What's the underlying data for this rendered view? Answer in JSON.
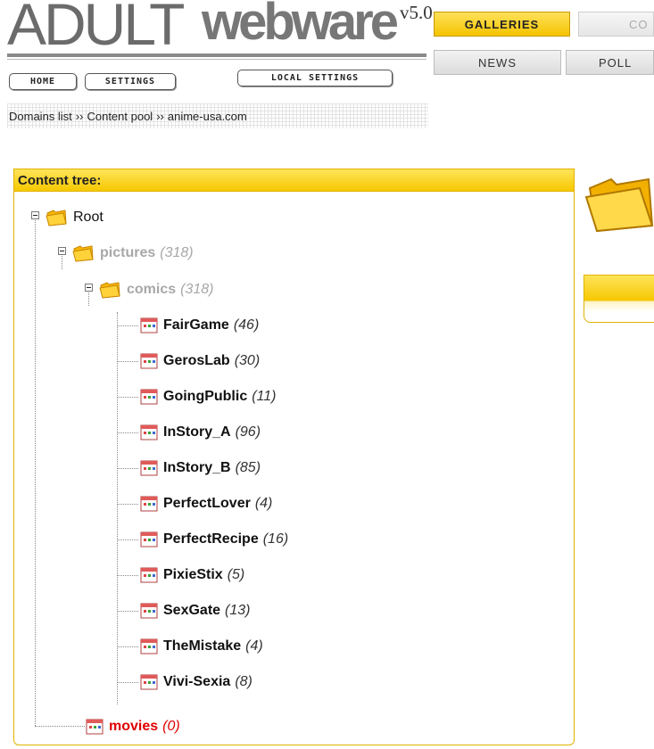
{
  "header": {
    "logo_adult": "ADULT",
    "logo_webware": "webware",
    "version": "v5.0",
    "buttons": {
      "home": "HOME",
      "settings": "SETTINGS",
      "local_settings": "LOCAL SETTINGS"
    },
    "tabs": {
      "galleries": "GALLERIES",
      "content": "CO",
      "news": "NEWS",
      "poll": "POLL"
    }
  },
  "breadcrumb": {
    "items": [
      "Domains list",
      "Content pool",
      "anime-usa.com"
    ],
    "separator": "››"
  },
  "tree": {
    "title": "Content tree:",
    "root": "Root",
    "pictures": {
      "name": "pictures",
      "count": "(318)"
    },
    "comics": {
      "name": "comics",
      "count": "(318)"
    },
    "galleries": [
      {
        "name": "FairGame",
        "count": "(46)"
      },
      {
        "name": "GerosLab",
        "count": "(30)"
      },
      {
        "name": "GoingPublic",
        "count": "(11)"
      },
      {
        "name": "InStory_A",
        "count": "(96)"
      },
      {
        "name": "InStory_B",
        "count": "(85)"
      },
      {
        "name": "PerfectLover",
        "count": "(4)"
      },
      {
        "name": "PerfectRecipe",
        "count": "(16)"
      },
      {
        "name": "PixieStix",
        "count": "(5)"
      },
      {
        "name": "SexGate",
        "count": "(13)"
      },
      {
        "name": "TheMistake",
        "count": "(4)"
      },
      {
        "name": "Vivi-Sexia",
        "count": "(8)"
      }
    ],
    "movies": {
      "name": "movies",
      "count": "(0)"
    }
  },
  "colors": {
    "accent": "#f6c800",
    "border": "#e1b200",
    "empty_red": "#e00000",
    "dim": "#a8a8a8"
  },
  "icons": {
    "folder": "folder-icon",
    "gallery": "gallery-icon",
    "toggle": "collapse-toggle-icon"
  }
}
